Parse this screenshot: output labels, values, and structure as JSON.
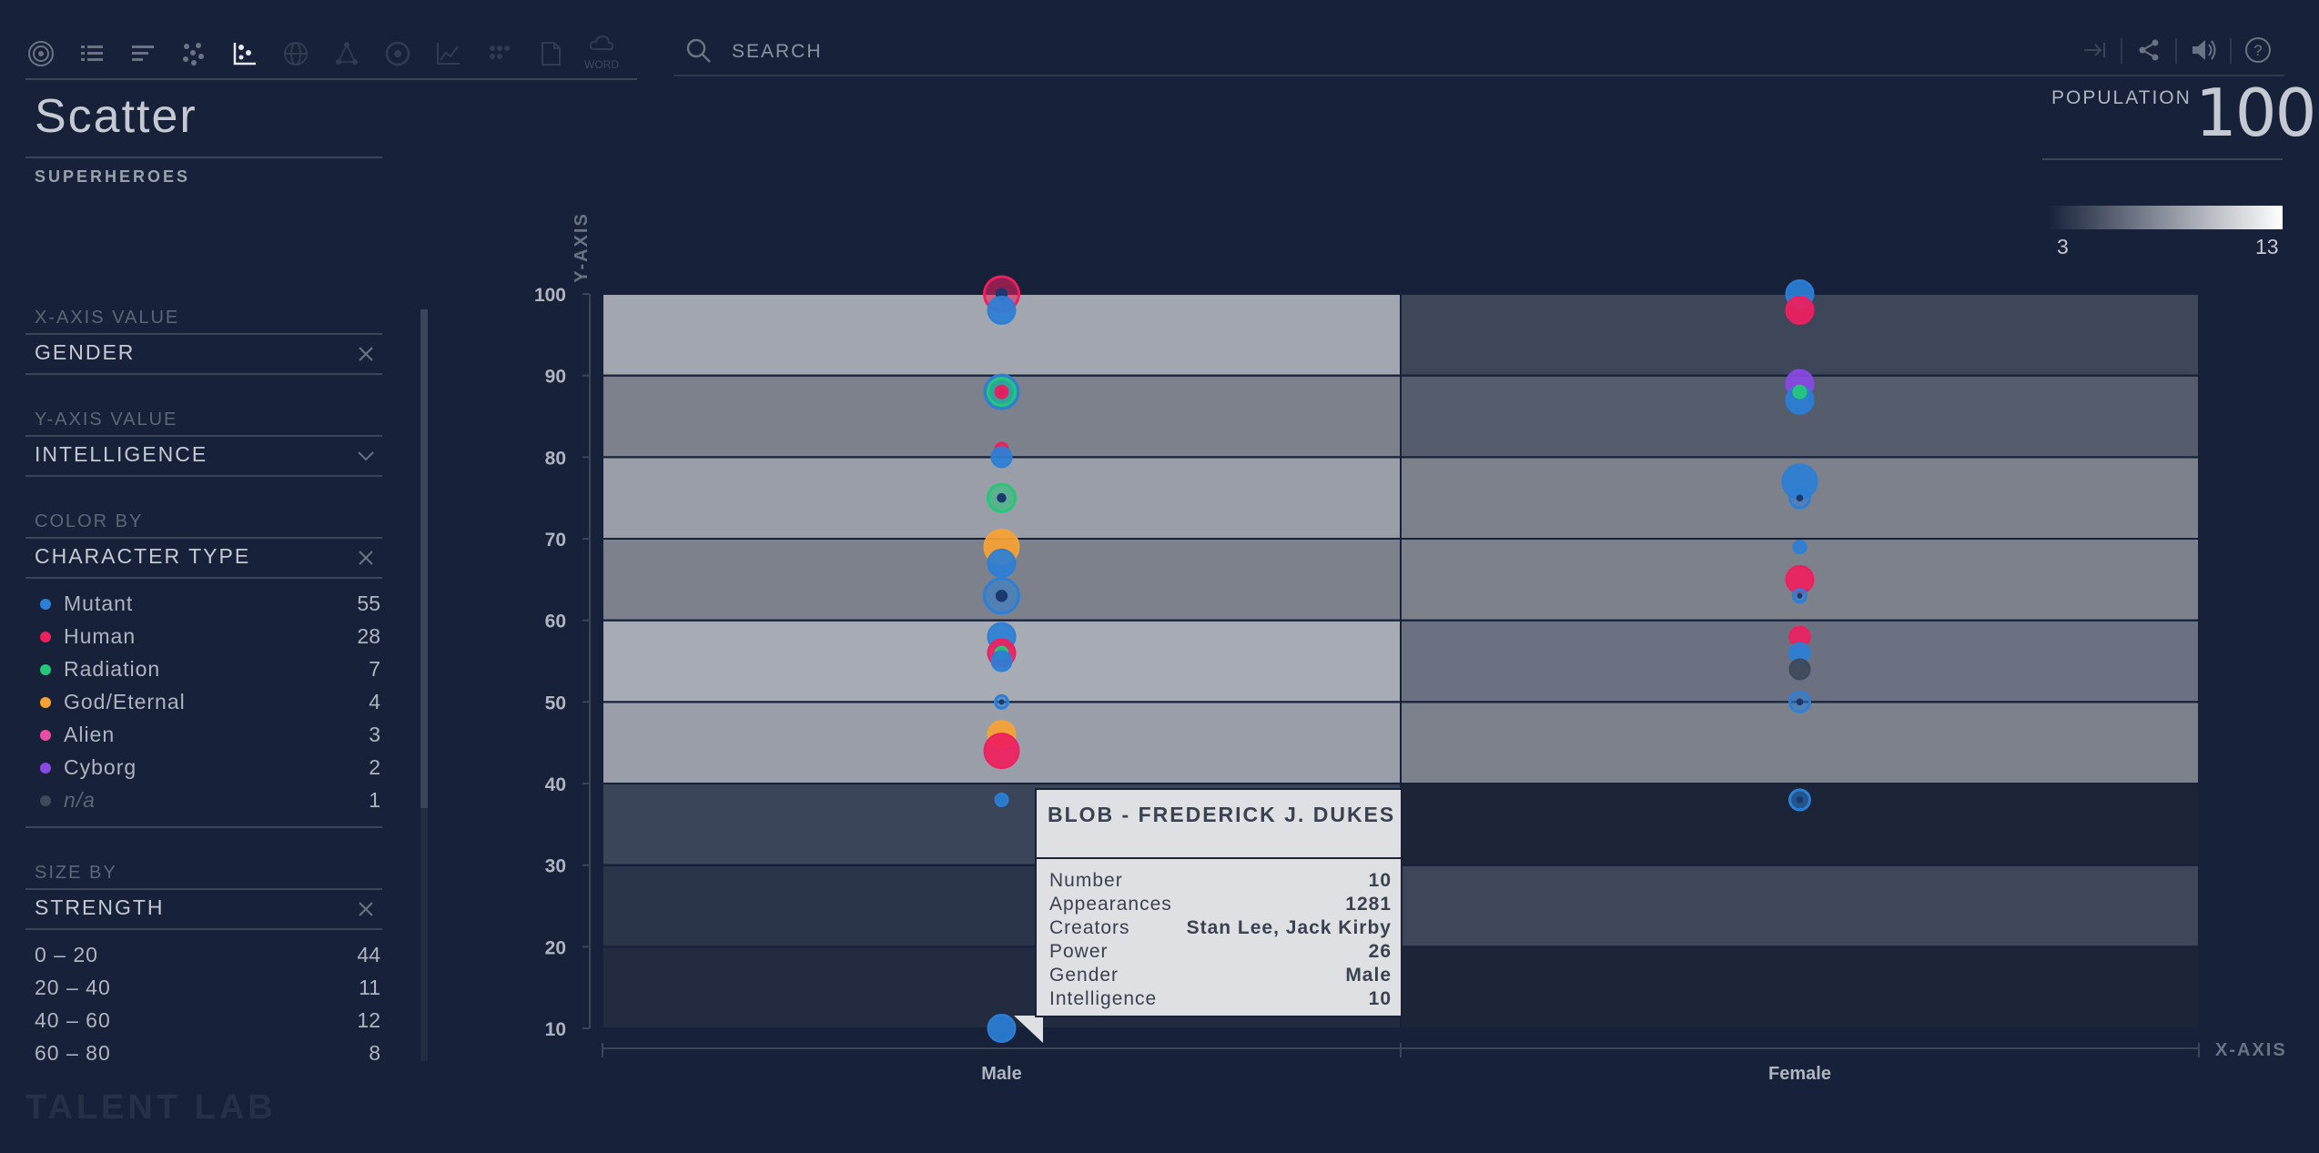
{
  "toolbar": {
    "icons": [
      "target-icon",
      "list-icon",
      "bars-icon",
      "bubble-icon",
      "scatter-icon",
      "globe-icon",
      "network-icon",
      "radial-icon",
      "line-chart-icon",
      "grid-icon",
      "document-icon",
      "word-cloud-icon"
    ],
    "active_icon": "scatter-icon",
    "word_label": "WORD"
  },
  "search": {
    "placeholder": "SEARCH"
  },
  "header_right_icons": [
    "exit-icon",
    "share-icon",
    "sound-icon",
    "help-icon"
  ],
  "page": {
    "title": "Scatter",
    "dataset": "SUPERHEROES"
  },
  "controls": {
    "x_axis": {
      "label": "X-AXIS VALUE",
      "value": "GENDER"
    },
    "y_axis": {
      "label": "Y-AXIS VALUE",
      "value": "INTELLIGENCE"
    },
    "color_by": {
      "label": "COLOR BY",
      "value": "CHARACTER TYPE",
      "items": [
        {
          "label": "Mutant",
          "count": "55",
          "color": "#2b7fd6"
        },
        {
          "label": "Human",
          "count": "28",
          "color": "#ef1f5e"
        },
        {
          "label": "Radiation",
          "count": "7",
          "color": "#24c777"
        },
        {
          "label": "God/Eternal",
          "count": "4",
          "color": "#f7a233"
        },
        {
          "label": "Alien",
          "count": "3",
          "color": "#ec4da4"
        },
        {
          "label": "Cyborg",
          "count": "2",
          "color": "#8a48e6"
        },
        {
          "label": "n/a",
          "count": "1",
          "color": "#3e4a5c"
        }
      ]
    },
    "size_by": {
      "label": "SIZE BY",
      "value": "STRENGTH",
      "items": [
        {
          "label": "0 – 20",
          "count": "44"
        },
        {
          "label": "20 – 40",
          "count": "11"
        },
        {
          "label": "40 – 60",
          "count": "12"
        },
        {
          "label": "60 – 80",
          "count": "8"
        }
      ]
    }
  },
  "population": {
    "label": "POPULATION",
    "value": "100"
  },
  "gradient_legend": {
    "min": "3",
    "max": "13"
  },
  "logo": "TALENT LAB",
  "chart_data": {
    "type": "scatter",
    "xlabel": "X-AXIS",
    "ylabel": "Y-AXIS",
    "categories": [
      "Male",
      "Female"
    ],
    "y_ticks": [
      10,
      20,
      30,
      40,
      50,
      60,
      70,
      80,
      90,
      100
    ],
    "ylim": [
      10,
      100
    ],
    "cell_shades": {
      "Male": [
        "#1c2538",
        "#222b3f",
        "#2b3549",
        "#3b4559",
        "#9a9ea8",
        "#a7abb3",
        "#7c818c",
        "#9a9ea8",
        "#7c818c",
        "#a2a6ae"
      ],
      "Female": [
        "#1c2538",
        "#1c2538",
        "#3e4759",
        "#1c2538",
        "#7c818c",
        "#6b7180",
        "#7c818c",
        "#7c818c",
        "#555c6c",
        "#3e4759"
      ]
    },
    "points": [
      {
        "x": "Male",
        "y": 100,
        "type": "Human",
        "strength": 4,
        "ring": true
      },
      {
        "x": "Male",
        "y": 98,
        "type": "Mutant",
        "strength": 3
      },
      {
        "x": "Male",
        "y": 88,
        "type": "Mutant",
        "strength": 4
      },
      {
        "x": "Male",
        "y": 88,
        "type": "Radiation",
        "strength": 3,
        "ring": true
      },
      {
        "x": "Male",
        "y": 88,
        "type": "Human",
        "strength": 1
      },
      {
        "x": "Male",
        "y": 81,
        "type": "Human",
        "strength": 1
      },
      {
        "x": "Male",
        "y": 80,
        "type": "Mutant",
        "strength": 2
      },
      {
        "x": "Male",
        "y": 75,
        "type": "Radiation",
        "strength": 3,
        "ring": true
      },
      {
        "x": "Male",
        "y": 69,
        "type": "God/Eternal",
        "strength": 4
      },
      {
        "x": "Male",
        "y": 67,
        "type": "Mutant",
        "strength": 3
      },
      {
        "x": "Male",
        "y": 63,
        "type": "Mutant",
        "strength": 4,
        "ring": true
      },
      {
        "x": "Male",
        "y": 58,
        "type": "Mutant",
        "strength": 3
      },
      {
        "x": "Male",
        "y": 56,
        "type": "Human",
        "strength": 3
      },
      {
        "x": "Male",
        "y": 56,
        "type": "Radiation",
        "strength": 1
      },
      {
        "x": "Male",
        "y": 55,
        "type": "Mutant",
        "strength": 2
      },
      {
        "x": "Male",
        "y": 50,
        "type": "Mutant",
        "strength": 1,
        "ring": true
      },
      {
        "x": "Male",
        "y": 46,
        "type": "God/Eternal",
        "strength": 3
      },
      {
        "x": "Male",
        "y": 44,
        "type": "Human",
        "strength": 4
      },
      {
        "x": "Male",
        "y": 38,
        "type": "Mutant",
        "strength": 1
      },
      {
        "x": "Male",
        "y": 10,
        "type": "Mutant",
        "strength": 3
      },
      {
        "x": "Female",
        "y": 100,
        "type": "Mutant",
        "strength": 3
      },
      {
        "x": "Female",
        "y": 98,
        "type": "Human",
        "strength": 3
      },
      {
        "x": "Female",
        "y": 89,
        "type": "Cyborg",
        "strength": 3
      },
      {
        "x": "Female",
        "y": 87,
        "type": "Mutant",
        "strength": 3
      },
      {
        "x": "Female",
        "y": 88,
        "type": "Radiation",
        "strength": 1
      },
      {
        "x": "Female",
        "y": 77,
        "type": "Mutant",
        "strength": 4
      },
      {
        "x": "Female",
        "y": 75,
        "type": "Mutant",
        "strength": 2,
        "ring": true
      },
      {
        "x": "Female",
        "y": 69,
        "type": "Mutant",
        "strength": 1
      },
      {
        "x": "Female",
        "y": 65,
        "type": "Human",
        "strength": 3
      },
      {
        "x": "Female",
        "y": 63,
        "type": "Mutant",
        "strength": 1,
        "ring": true
      },
      {
        "x": "Female",
        "y": 58,
        "type": "Human",
        "strength": 2
      },
      {
        "x": "Female",
        "y": 56,
        "type": "Mutant",
        "strength": 2
      },
      {
        "x": "Female",
        "y": 54,
        "type": "n/a",
        "strength": 2
      },
      {
        "x": "Female",
        "y": 50,
        "type": "Mutant",
        "strength": 2,
        "ring": true
      },
      {
        "x": "Female",
        "y": 38,
        "type": "Mutant",
        "strength": 2,
        "ring": true
      }
    ]
  },
  "tooltip": {
    "title": "BLOB - FREDERICK J. DUKES",
    "rows": [
      {
        "key": "Number",
        "value": "10"
      },
      {
        "key": "Appearances",
        "value": "1281"
      },
      {
        "key": "Creators",
        "value": "Stan Lee, Jack Kirby"
      },
      {
        "key": "Power",
        "value": "26"
      },
      {
        "key": "Gender",
        "value": "Male"
      },
      {
        "key": "Intelligence",
        "value": "10"
      }
    ]
  }
}
